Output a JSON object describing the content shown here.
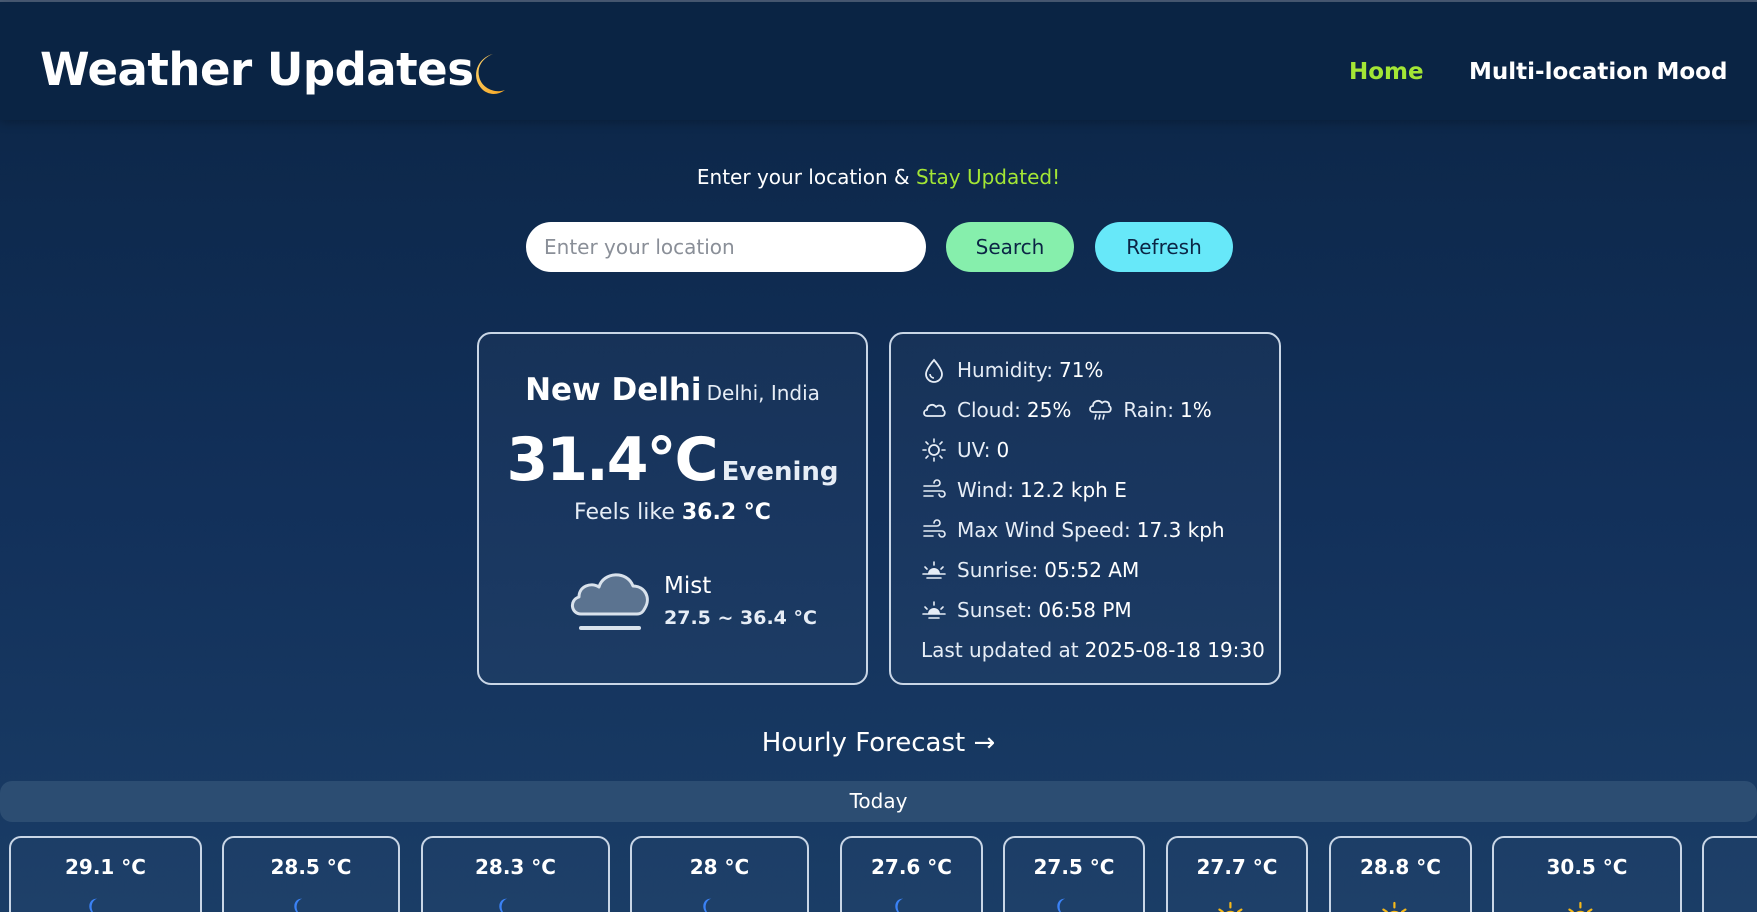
{
  "app": {
    "title": "Weather Updates",
    "logo_icon": "crescent-moon-icon"
  },
  "nav": {
    "items": [
      {
        "label": "Home",
        "active": true,
        "color": "#a3e635"
      },
      {
        "label": "Multi-location Mood",
        "active": false
      }
    ]
  },
  "tagline": {
    "prefix": "Enter your location & ",
    "accent": "Stay Updated!"
  },
  "search": {
    "value": "",
    "placeholder": "Enter your location",
    "search_label": "Search",
    "refresh_label": "Refresh"
  },
  "current": {
    "city": "New Delhi",
    "region": "Delhi, India",
    "temperature": "31.4°C",
    "period": "Evening",
    "feels_like_label": "Feels like",
    "feels_like": "36.2 °C",
    "condition": "Mist",
    "condition_icon": "mist-cloud-icon",
    "range": "27.5 ~ 36.4 °C"
  },
  "details": {
    "humidity": {
      "label": "Humidity:",
      "value": "71%",
      "icon": "humidity-icon"
    },
    "cloud": {
      "label": "Cloud:",
      "value": "25%",
      "icon": "cloud-icon"
    },
    "rain": {
      "label": "Rain:",
      "value": "1%",
      "icon": "rain-icon"
    },
    "uv": {
      "label": "UV:",
      "value": "0",
      "icon": "sun-icon"
    },
    "wind": {
      "label": "Wind:",
      "value": "12.2 kph E",
      "icon": "wind-icon"
    },
    "max_wind": {
      "label": "Max Wind Speed:",
      "value": "17.3 kph",
      "icon": "wind-icon"
    },
    "sunrise": {
      "label": "Sunrise:",
      "value": "05:52 AM",
      "icon": "sunrise-icon"
    },
    "sunset": {
      "label": "Sunset:",
      "value": "06:58 PM",
      "icon": "sunset-icon"
    },
    "last_updated_label": "Last updated at",
    "last_updated": "2025-08-18 19:30"
  },
  "hourly": {
    "title": "Hourly Forecast →",
    "day_label": "Today",
    "items": [
      {
        "temp": "29.1 °C",
        "icon": "cloud-night-icon"
      },
      {
        "temp": "28.5 °C",
        "icon": "cloud-night-icon"
      },
      {
        "temp": "28.3 °C",
        "icon": "cloud-night-icon"
      },
      {
        "temp": "28 °C",
        "icon": "cloud-night-icon"
      },
      {
        "temp": "27.6 °C",
        "icon": "cloud-night-icon"
      },
      {
        "temp": "27.5 °C",
        "icon": "cloud-night-icon"
      },
      {
        "temp": "27.7 °C",
        "icon": "cloud-sun-icon"
      },
      {
        "temp": "28.8 °C",
        "icon": "cloud-sun-icon"
      },
      {
        "temp": "30.5 °C",
        "icon": "cloud-sun-icon"
      },
      {
        "temp": "",
        "icon": ""
      }
    ]
  },
  "colors": {
    "accent": "#a3e635",
    "search_button": "#86efac",
    "refresh_button": "#67e8f9",
    "background": "#12305a"
  }
}
